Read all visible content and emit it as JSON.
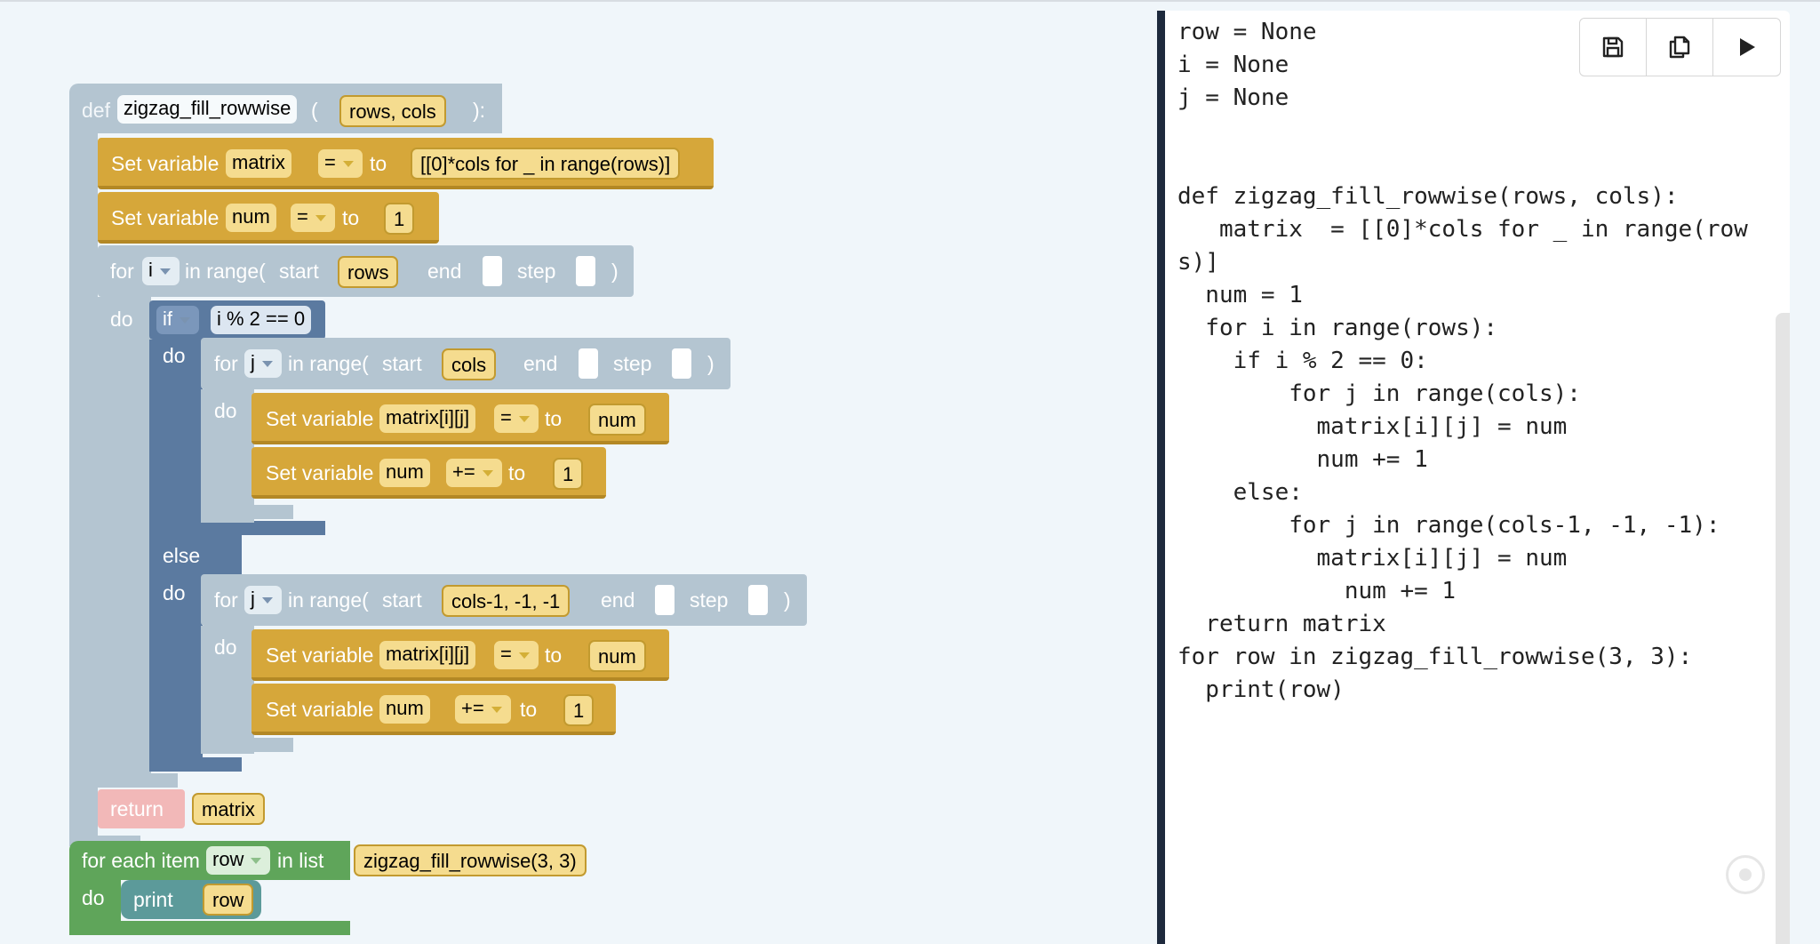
{
  "blocks": {
    "def": {
      "keyword": "def",
      "name": "zigzag_fill_rowwise",
      "open": "(",
      "params": "rows, cols",
      "close": "):"
    },
    "set_matrix": {
      "label": "Set variable",
      "var": "matrix",
      "op": "=",
      "to": "to",
      "value": "[[0]*cols for _ in range(rows)]"
    },
    "set_num": {
      "label": "Set variable",
      "var": "num",
      "op": "=",
      "to": "to",
      "value": "1"
    },
    "for_i": {
      "for": "for",
      "var": "i",
      "range": "in range(",
      "start_label": "start",
      "start": "rows",
      "end_label": "end",
      "step_label": "step",
      "close": ")",
      "do": "do"
    },
    "if_block": {
      "if": "if",
      "cond": "i % 2 == 0",
      "do": "do",
      "else": "else",
      "else_do": "do"
    },
    "for_j1": {
      "for": "for",
      "var": "j",
      "range": "in range(",
      "start_label": "start",
      "start": "cols",
      "end_label": "end",
      "step_label": "step",
      "close": ")",
      "do": "do"
    },
    "set_mij1": {
      "label": "Set variable",
      "var": "matrix[i][j]",
      "op": "=",
      "to": "to",
      "value": "num"
    },
    "inc_num1": {
      "label": "Set variable",
      "var": "num",
      "op": "+=",
      "to": "to",
      "value": "1"
    },
    "for_j2": {
      "for": "for",
      "var": "j",
      "range": "in range(",
      "start_label": "start",
      "start": "cols-1, -1, -1",
      "end_label": "end",
      "step_label": "step",
      "close": ")",
      "do": "do"
    },
    "set_mij2": {
      "label": "Set variable",
      "var": "matrix[i][j]",
      "op": "=",
      "to": "to",
      "value": "num"
    },
    "inc_num2": {
      "label": "Set variable",
      "var": "num",
      "op": "+=",
      "to": "to",
      "value": "1"
    },
    "return": {
      "label": "return",
      "value": "matrix"
    },
    "foreach": {
      "label": "for each item",
      "var": "row",
      "in_list": "in list",
      "list": "zigzag_fill_rowwise(3, 3)",
      "do": "do"
    },
    "print": {
      "label": "print",
      "value": "row"
    }
  },
  "editor": {
    "code": "row = None\ni = None\nj = None\n\n\ndef zigzag_fill_rowwise(rows, cols):\n   matrix  = [[0]*cols for _ in range(row\ns)]\n  num = 1\n  for i in range(rows):\n    if i % 2 == 0:\n        for j in range(cols):\n          matrix[i][j] = num\n          num += 1\n    else:\n        for j in range(cols-1, -1, -1):\n          matrix[i][j] = num\n            num += 1\n  return matrix\nfor row in zigzag_fill_rowwise(3, 3):\n  print(row)",
    "toolbar": [
      "save-icon",
      "copy-icon",
      "run-icon"
    ]
  },
  "colors": {
    "function_block": "#b4c5d1",
    "variable_block": "#d6a73a",
    "logic_block": "#5b7aa0",
    "loop_block": "#5fa55a",
    "return_block": "#f2b8b8",
    "print_block": "#5c9a9a",
    "editor_border": "#1e2a3d"
  }
}
